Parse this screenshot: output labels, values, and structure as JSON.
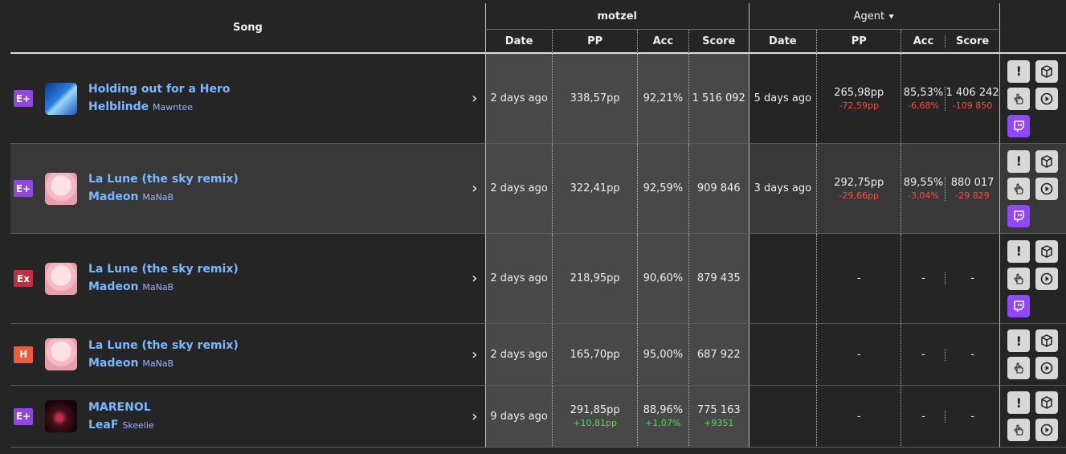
{
  "header": {
    "song": "Song",
    "player": "motzel",
    "compare": "Agent",
    "columns": {
      "date": "Date",
      "pp": "PP",
      "acc": "Acc",
      "score": "Score"
    }
  },
  "rows": [
    {
      "difficulty": "E+",
      "diff_color": "#8f48db",
      "title": "Holding out for a Hero",
      "artist": "Helblinde",
      "mapper": "Mawntee",
      "cover": "blue-abstract",
      "me": {
        "date": "2 days ago",
        "pp": "338,57pp",
        "acc": "92,21%",
        "score": "1 516 092"
      },
      "other": {
        "date": "5 days ago",
        "pp": "265,98pp",
        "acc": "85,53%",
        "score": "1 406 242"
      },
      "delta": {
        "pp": "-72,59pp",
        "acc": "-6,68%",
        "score": "-109 850",
        "sign": "neg"
      },
      "twitch": true
    },
    {
      "difficulty": "E+",
      "diff_color": "#8f48db",
      "title": "La Lune (the sky remix)",
      "artist": "Madeon",
      "mapper": "MaNaB",
      "cover": "anime-girl",
      "me": {
        "date": "2 days ago",
        "pp": "322,41pp",
        "acc": "92,59%",
        "score": "909 846"
      },
      "other": {
        "date": "3 days ago",
        "pp": "292,75pp",
        "acc": "89,55%",
        "score": "880 017"
      },
      "delta": {
        "pp": "-29,66pp",
        "acc": "-3,04%",
        "score": "-29 829",
        "sign": "neg"
      },
      "twitch": true
    },
    {
      "difficulty": "Ex",
      "diff_color": "#c03040",
      "title": "La Lune (the sky remix)",
      "artist": "Madeon",
      "mapper": "MaNaB",
      "cover": "anime-girl",
      "me": {
        "date": "2 days ago",
        "pp": "218,95pp",
        "acc": "90,60%",
        "score": "879 435"
      },
      "other": {
        "date": "",
        "pp": "-",
        "acc": "-",
        "score": "-"
      },
      "delta": {
        "pp": "",
        "acc": "",
        "score": "",
        "sign": "neg"
      },
      "twitch": true
    },
    {
      "difficulty": "H",
      "diff_color": "#ee5a3a",
      "title": "La Lune (the sky remix)",
      "artist": "Madeon",
      "mapper": "MaNaB",
      "cover": "anime-girl",
      "me": {
        "date": "2 days ago",
        "pp": "165,70pp",
        "acc": "95,00%",
        "score": "687 922"
      },
      "other": {
        "date": "",
        "pp": "-",
        "acc": "-",
        "score": "-"
      },
      "delta": {
        "pp": "",
        "acc": "",
        "score": "",
        "sign": "neg"
      },
      "twitch": false
    },
    {
      "difficulty": "E+",
      "diff_color": "#8f48db",
      "title": "MARENOL",
      "artist": "LeaF",
      "mapper": "Skeelie",
      "cover": "dark-red",
      "me": {
        "date": "9 days ago",
        "pp": "291,85pp",
        "acc": "88,96%",
        "score": "775 163"
      },
      "other": {
        "date": "",
        "pp": "-",
        "acc": "-",
        "score": "-"
      },
      "delta": {
        "pp": "+10,81pp",
        "acc": "+1,07%",
        "score": "+9351",
        "sign": "pos"
      },
      "delta_on_me": true,
      "twitch": false
    }
  ],
  "icons": {
    "exclaim": "exclamation-icon",
    "box": "cube-icon",
    "hand": "pointer-hand-icon",
    "play": "play-icon",
    "twitch": "twitch-icon",
    "chevron": "chevron-right-icon"
  }
}
